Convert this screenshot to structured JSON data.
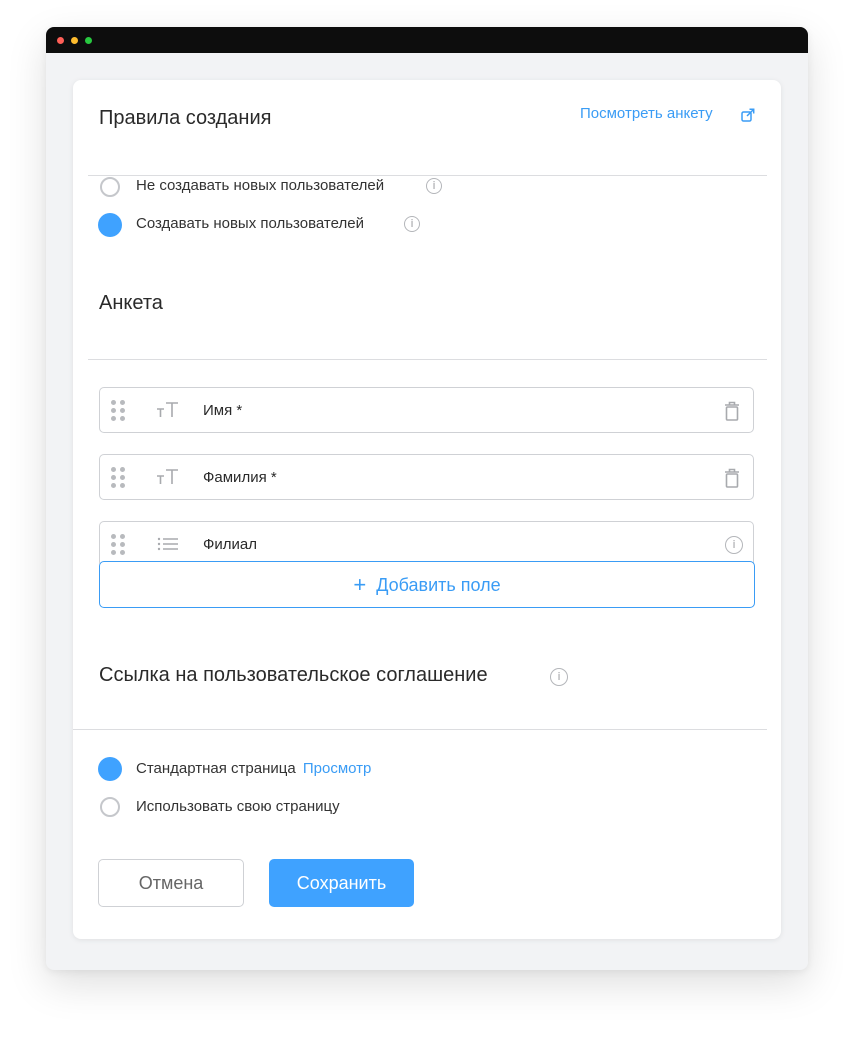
{
  "rules": {
    "title": "Правила создания",
    "view_form_link": "Посмотреть анкету",
    "options": [
      {
        "label": "Не создавать новых пользователей",
        "selected": false
      },
      {
        "label": "Создавать новых пользователей",
        "selected": true
      }
    ]
  },
  "form": {
    "title": "Анкета",
    "fields": [
      {
        "label": "Имя *",
        "type_icon": "text-type-icon",
        "action_icon": "trash-icon"
      },
      {
        "label": "Фамилия *",
        "type_icon": "text-type-icon",
        "action_icon": "trash-icon"
      },
      {
        "label": "Филиал",
        "type_icon": "list-type-icon",
        "action_icon": "info-icon"
      }
    ],
    "add_field_label": "Добавить поле"
  },
  "agreement": {
    "title": "Ссылка на пользовательское соглашение",
    "options": [
      {
        "label": "Стандартная страница",
        "link": "Просмотр",
        "selected": true
      },
      {
        "label": "Использовать свою страницу",
        "selected": false
      }
    ]
  },
  "actions": {
    "cancel_label": "Отмена",
    "save_label": "Сохранить"
  },
  "colors": {
    "accent": "#3a9cf5",
    "radio_selected": "#3fa2ff",
    "titlebar": "#0d0d0d"
  }
}
